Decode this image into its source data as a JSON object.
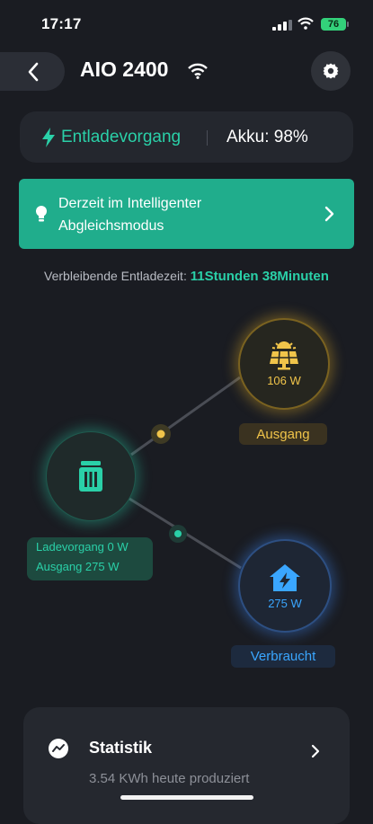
{
  "status_bar": {
    "time": "17:17",
    "battery": "76"
  },
  "header": {
    "title": "AIO 2400"
  },
  "status": {
    "state": "Entladevorgang",
    "battery_label": "Akku: 98%"
  },
  "mode": {
    "line1": "Derzeit im Intelligenter",
    "line2": "Abgleichsmodus"
  },
  "remaining": {
    "label": "Verbleibende Entladezeit: ",
    "value": "11Stunden 38Minuten"
  },
  "diagram": {
    "solar": {
      "value": "106 W",
      "label": "Ausgang"
    },
    "home": {
      "value": "275 W",
      "label": "Verbraucht"
    },
    "battery": {
      "charging": "Ladevorgang  0 W",
      "output": "Ausgang  275 W"
    }
  },
  "stats": {
    "title": "Statistik",
    "subtitle": "3.54 KWh heute produziert"
  },
  "colors": {
    "accent": "#2ad0a8",
    "solar": "#f0c44a",
    "home": "#3aa6ff",
    "banner": "#20ad8c"
  }
}
